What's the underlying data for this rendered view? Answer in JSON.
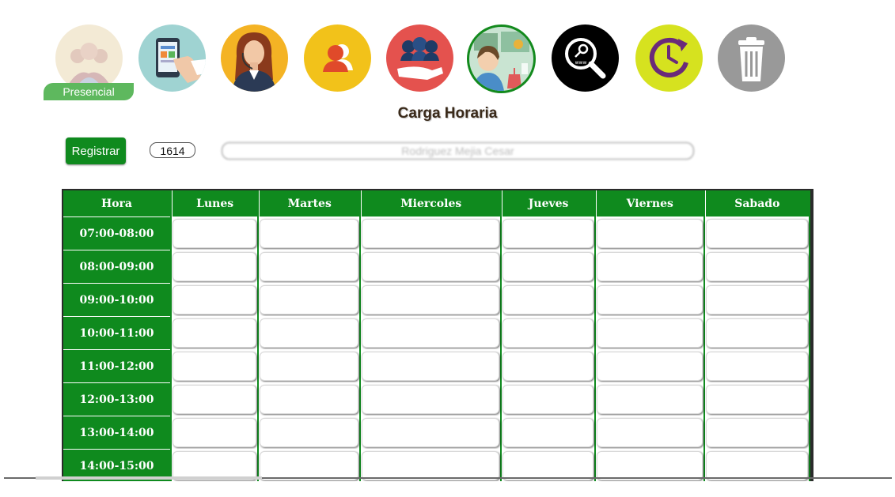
{
  "app": {
    "title": "Carga Horaria"
  },
  "toolbar": {
    "icons": [
      {
        "name": "presencial-icon",
        "label": "Presencial"
      },
      {
        "name": "tablet-touch-icon"
      },
      {
        "name": "secretary-icon"
      },
      {
        "name": "user-profile-icon"
      },
      {
        "name": "group-hand-icon"
      },
      {
        "name": "science-teacher-icon"
      },
      {
        "name": "web-search-icon"
      },
      {
        "name": "clock-history-icon"
      },
      {
        "name": "trash-icon"
      }
    ]
  },
  "form": {
    "register_label": "Registrar",
    "code_value": "1614",
    "name_value": "Rodriguez Mejia Cesar"
  },
  "schedule": {
    "headers": [
      "Hora",
      "Lunes",
      "Martes",
      "Miercoles",
      "Jueves",
      "Viernes",
      "Sabado"
    ],
    "hours": [
      "07:00-08:00",
      "08:00-09:00",
      "09:00-10:00",
      "10:00-11:00",
      "11:00-12:00",
      "12:00-13:00",
      "13:00-14:00",
      "14:00-15:00"
    ]
  },
  "colors": {
    "primary_green": "#0f8a1e",
    "tag_green": "#5eb85e",
    "title_brown": "#3a2a1a"
  }
}
